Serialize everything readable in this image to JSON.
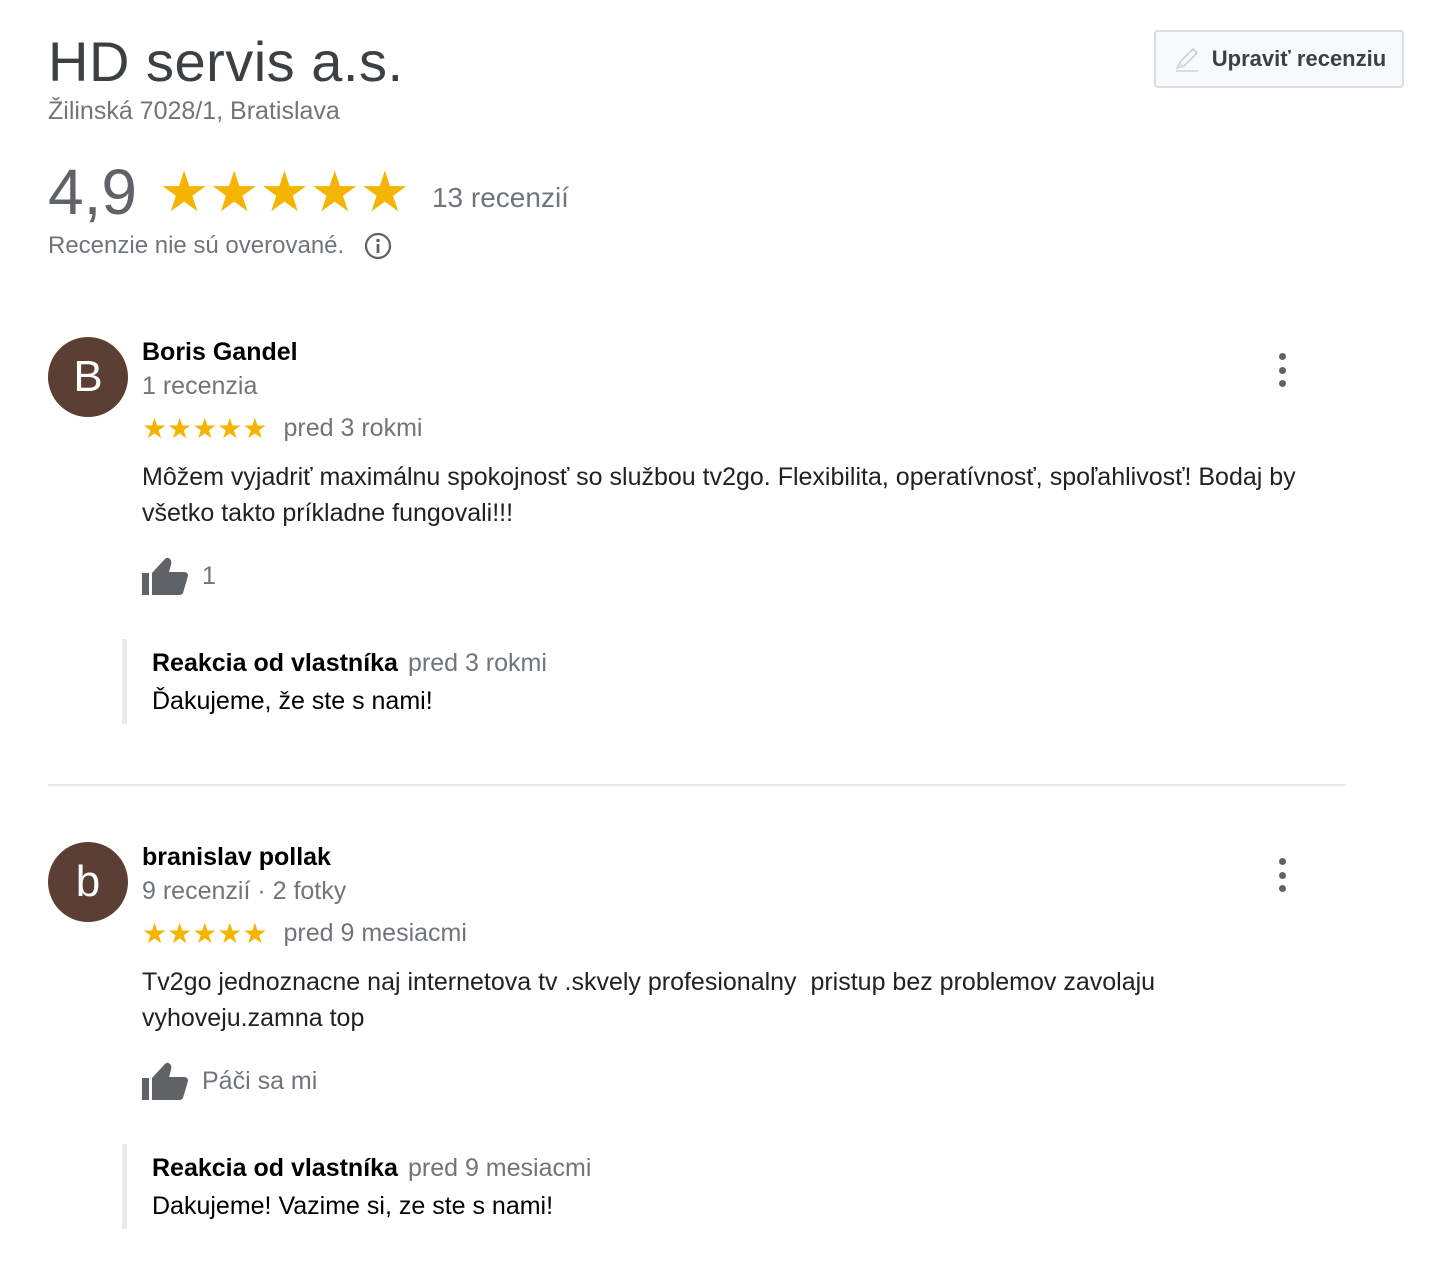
{
  "business": {
    "name": "HD servis a.s.",
    "address": "Žilinská 7028/1, Bratislava",
    "edit_review_label": "Upraviť recenziu",
    "rating": "4,9",
    "stars": "★★★★★",
    "review_count": "13 recenzií",
    "unverified_note": "Recenzie nie sú overované."
  },
  "reviews": [
    {
      "initial": "B",
      "name": "Boris Gandel",
      "meta": "1 recenzia",
      "stars": "★★★★★",
      "date": "pred 3 rokmi",
      "text": "Môžem vyjadriť maximálnu spokojnosť so službou tv2go. Flexibilita, operatívnosť, spoľahlivosť! Bodaj by všetko takto príkladne fungovali!!!",
      "like_label": "1",
      "reply_title": "Reakcia od vlastníka",
      "reply_date": "pred 3 rokmi",
      "reply_text": "Ďakujeme, že ste s nami!"
    },
    {
      "initial": "b",
      "name": "branislav pollak",
      "meta": "9 recenzií · 2 fotky",
      "stars": "★★★★★",
      "date": "pred 9 mesiacmi",
      "text": "Tv2go jednoznacne naj internetova tv .skvely profesionalny  pristup bez problemov zavolaju vyhoveju.zamna top",
      "like_label": "Páči sa mi",
      "reply_title": "Reakcia od vlastníka",
      "reply_date": "pred 9 mesiacmi",
      "reply_text": "Dakujeme! Vazime si, ze ste s nami!"
    }
  ],
  "icons": {
    "edit": "pencil-icon",
    "info": "info-icon",
    "like": "thumbs-up-icon",
    "menu": "more-vert-icon"
  },
  "colors": {
    "star": "#f4b400",
    "avatar": "#5b3f34",
    "muted": "#70757a"
  }
}
